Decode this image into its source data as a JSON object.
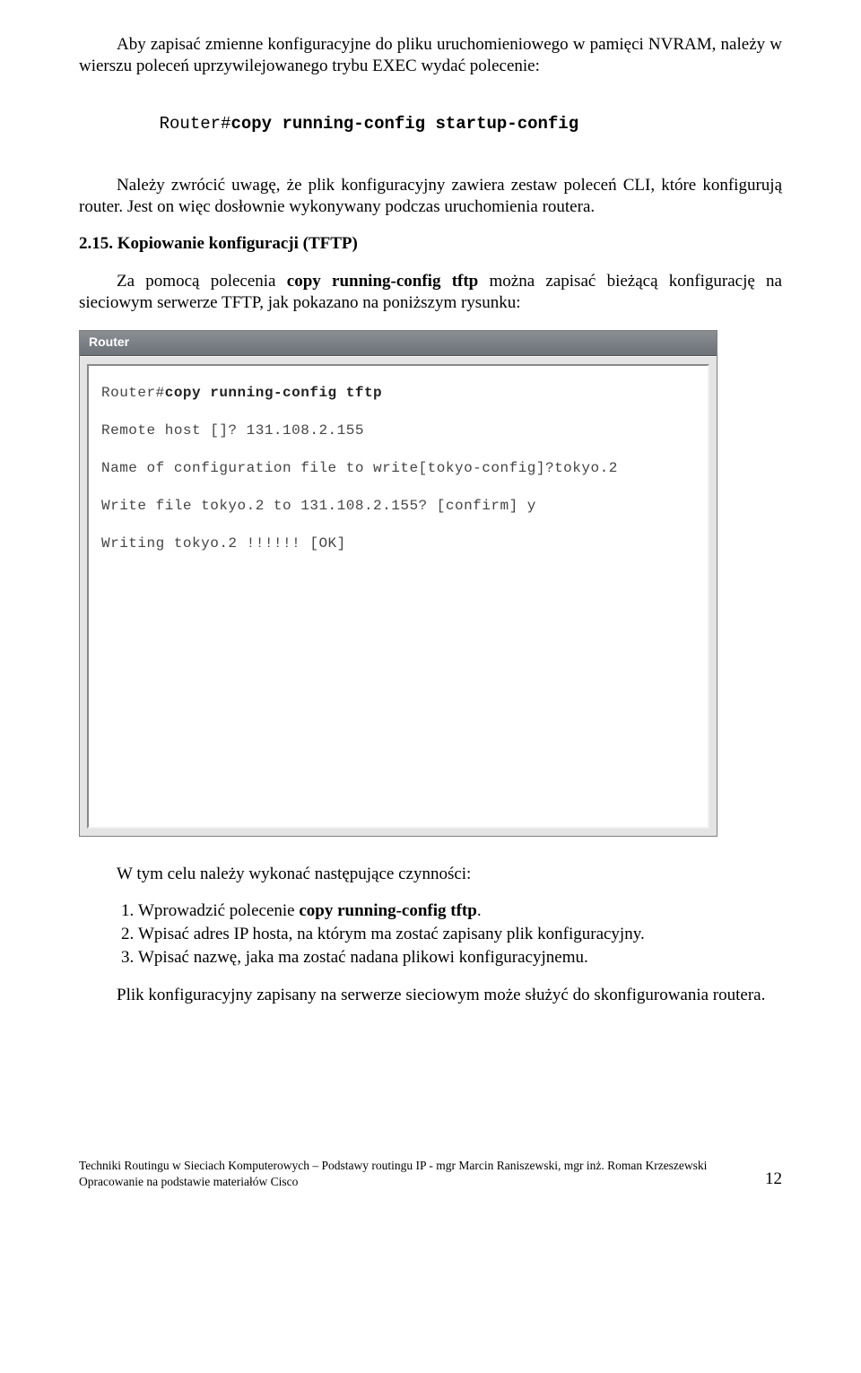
{
  "para1": "Aby zapisać zmienne konfiguracyjne do pliku uruchomieniowego w pamięci NVRAM, należy w wierszu poleceń uprzywilejowanego trybu EXEC wydać polecenie:",
  "cmd1_prefix": "Router#",
  "cmd1_bold": "copy running-config startup-config",
  "para2": "Należy zwrócić uwagę, że plik konfiguracyjny zawiera zestaw poleceń CLI, które konfigurują router. Jest on więc dosłownie wykonywany podczas uruchomienia routera.",
  "section_title": "2.15. Kopiowanie konfiguracji (TFTP)",
  "para3_a": "Za pomocą polecenia ",
  "para3_b": "copy running-config tftp",
  "para3_c": " można zapisać bieżącą konfigurację na sieciowym serwerze TFTP, jak pokazano na poniższym rysunku:",
  "terminal": {
    "title": "Router",
    "l1_prefix": "Router#",
    "l1_bold": "copy running-config tftp",
    "l2": "Remote host []? 131.108.2.155",
    "l3": "Name of configuration file to write[tokyo-config]?tokyo.2",
    "l4": "Write file tokyo.2 to 131.108.2.155? [confirm] y",
    "l5": "Writing tokyo.2 !!!!!! [OK]"
  },
  "para4": "W tym celu należy wykonać następujące czynności:",
  "steps": {
    "s1a": "Wprowadzić polecenie ",
    "s1b": "copy running-config tftp",
    "s1c": ".",
    "s2": "Wpisać adres IP hosta, na którym ma zostać zapisany plik konfiguracyjny.",
    "s3": "Wpisać nazwę, jaka ma zostać nadana plikowi konfiguracyjnemu."
  },
  "para5": "Plik konfiguracyjny zapisany na serwerze sieciowym może służyć do skonfigurowania routera.",
  "footer_line1": "Techniki Routingu w Sieciach Komputerowych – Podstawy routingu IP - mgr Marcin Raniszewski, mgr inż. Roman Krzeszewski",
  "footer_line2": "Opracowanie na podstawie materiałów Cisco",
  "page_number": "12"
}
